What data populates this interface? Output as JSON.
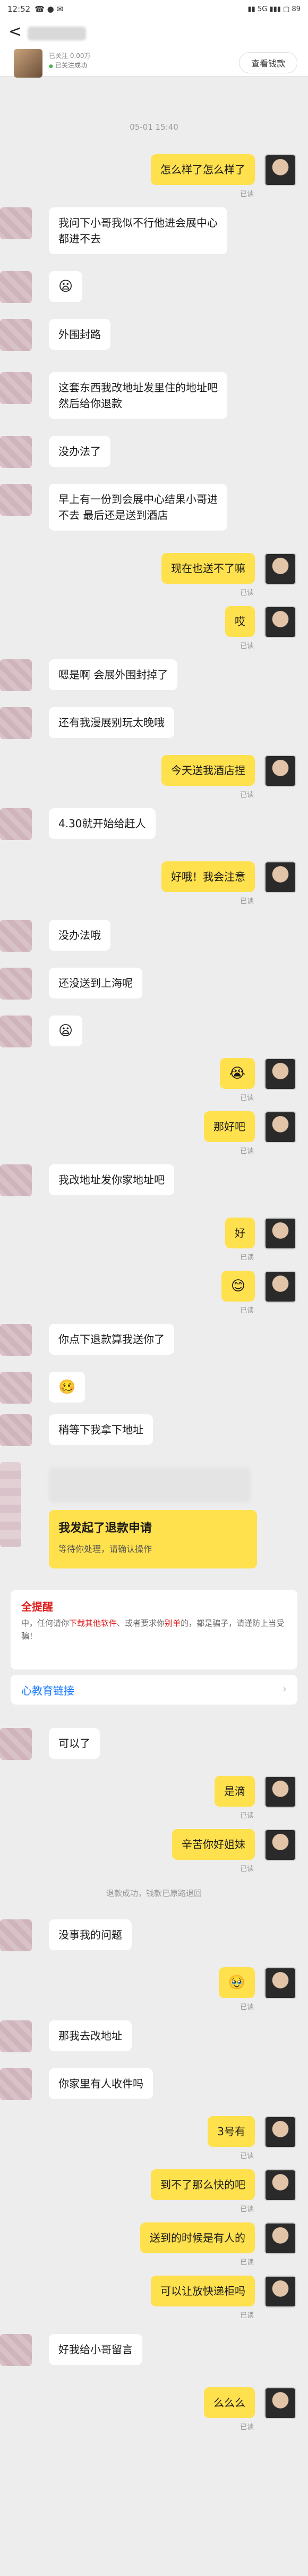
{
  "status": {
    "time": "12:52",
    "icons": "☎ ● ✉",
    "system": "▮▮ 5G ▮▮▮ ▢ 89"
  },
  "header": {
    "back": "<",
    "meta_line1": "已关注 0.00万",
    "meta_line2": "已关注成功",
    "view_money": "查看钱款"
  },
  "chat": {
    "date": "05-01 15:40",
    "messages": [
      {
        "side": "right",
        "text": "怎么样了怎么样了"
      },
      {
        "side": "left",
        "text": "我问下小哥我似不行他进会展中心\n都进不去"
      },
      {
        "side": "left",
        "text": "😦"
      },
      {
        "side": "left",
        "text": "外围封路"
      },
      {
        "side": "left",
        "text": "这套东西我改地址发里住的地址吧\n然后给你退款"
      },
      {
        "side": "left",
        "text": "没办法了"
      },
      {
        "side": "left",
        "text": "早上有一份到会展中心结果小哥进\n不去 最后还是送到酒店"
      },
      {
        "side": "right",
        "text": "现在也送不了嘛"
      },
      {
        "side": "right",
        "text": "哎"
      },
      {
        "side": "left",
        "text": "嗯是啊 会展外围封掉了"
      },
      {
        "side": "left",
        "text": "还有我漫展别玩太晚哦"
      },
      {
        "side": "right",
        "text": "今天送我酒店捏"
      },
      {
        "side": "left",
        "text": "4.30就开始给赶人"
      },
      {
        "side": "right",
        "text": "好哦！我会注意"
      },
      {
        "side": "left",
        "text": "没办法哦"
      },
      {
        "side": "left",
        "text": "还没送到上海呢"
      },
      {
        "side": "left",
        "text": "😦"
      },
      {
        "side": "right",
        "text": "😭"
      },
      {
        "side": "right",
        "text": "那好吧"
      },
      {
        "side": "left",
        "text": "我改地址发你家地址吧"
      },
      {
        "side": "right",
        "text": "好"
      },
      {
        "side": "right",
        "text": "😊"
      },
      {
        "side": "left",
        "text": "你点下退款算我送你了"
      },
      {
        "side": "left",
        "text": "🥴"
      },
      {
        "side": "left",
        "text": "稍等下我拿下地址"
      },
      {
        "side": "left",
        "text": "可以了"
      },
      {
        "side": "right",
        "text": "是滴"
      },
      {
        "side": "right",
        "text": "辛苦你好姐妹"
      },
      {
        "side": "left",
        "text": "没事我的问题"
      },
      {
        "side": "right",
        "text": "🥹"
      },
      {
        "side": "left",
        "text": "那我去改地址"
      },
      {
        "side": "left",
        "text": "你家里有人收件吗"
      },
      {
        "side": "right",
        "text": "3号有"
      },
      {
        "side": "right",
        "text": "到不了那么快的吧"
      },
      {
        "side": "right",
        "text": "送到的时候是有人的"
      },
      {
        "side": "right",
        "text": "可以让放快递柜吗"
      },
      {
        "side": "left",
        "text": "好我给小哥留言"
      },
      {
        "side": "right",
        "text": "么么么"
      }
    ],
    "read_label": "已读",
    "refund": {
      "title": "我发起了退款申请",
      "sub": "等待你处理，请确认操作"
    },
    "warning": {
      "title": "全提醒",
      "text_1": "中，任何请你",
      "text_hl": "下载其他软件",
      "text_2": "、或者要求你",
      "text_hl2": "别单",
      "text_3": "的，都是骗子，请谨防上当受骗！",
      "link": "心教育链接"
    },
    "refund_done": "退款成功，钱款已原路退回"
  }
}
